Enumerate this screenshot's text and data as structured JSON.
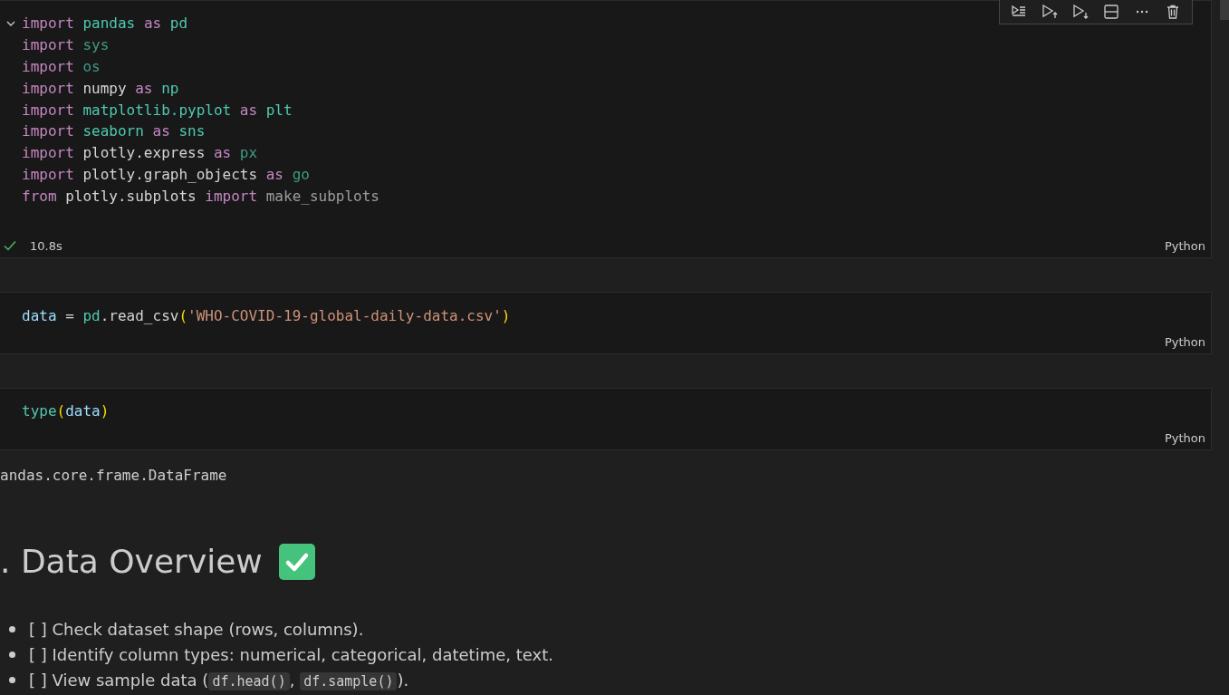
{
  "cell_toolbar": {
    "buttons": [
      {
        "kind": "run-by-line"
      },
      {
        "kind": "run-above"
      },
      {
        "kind": "run-below"
      },
      {
        "kind": "split"
      },
      {
        "kind": "more"
      },
      {
        "kind": "delete"
      }
    ]
  },
  "cells": [
    {
      "kind": "code",
      "expanded": true,
      "succeeded": true,
      "duration": "10.8s",
      "language": "Python",
      "lines": [
        [
          {
            "text": "import ",
            "kind": "kw"
          },
          {
            "text": "pandas ",
            "kind": "mod"
          },
          {
            "text": "as ",
            "kind": "kw"
          },
          {
            "text": "pd",
            "kind": "mod"
          }
        ],
        [
          {
            "text": "import ",
            "kind": "kw"
          },
          {
            "text": "sys",
            "kind": "mod_dim"
          }
        ],
        [
          {
            "text": "import ",
            "kind": "kw"
          },
          {
            "text": "os",
            "kind": "mod_dim"
          }
        ],
        [
          {
            "text": "import ",
            "kind": "kw"
          },
          {
            "text": "numpy ",
            "kind": "plain"
          },
          {
            "text": "as ",
            "kind": "kw"
          },
          {
            "text": "np",
            "kind": "mod"
          }
        ],
        [
          {
            "text": "import ",
            "kind": "kw"
          },
          {
            "text": "matplotlib.pyplot ",
            "kind": "mod"
          },
          {
            "text": "as ",
            "kind": "kw"
          },
          {
            "text": "plt",
            "kind": "mod"
          }
        ],
        [
          {
            "text": "import ",
            "kind": "kw"
          },
          {
            "text": "seaborn ",
            "kind": "mod"
          },
          {
            "text": "as ",
            "kind": "kw"
          },
          {
            "text": "sns",
            "kind": "mod"
          }
        ],
        [
          {
            "text": "import ",
            "kind": "kw"
          },
          {
            "text": "plotly.express ",
            "kind": "plain"
          },
          {
            "text": "as ",
            "kind": "kw"
          },
          {
            "text": "px",
            "kind": "mod_dim"
          }
        ],
        [
          {
            "text": "import ",
            "kind": "kw"
          },
          {
            "text": "plotly.graph_objects ",
            "kind": "plain"
          },
          {
            "text": "as ",
            "kind": "kw"
          },
          {
            "text": "go",
            "kind": "mod_dim"
          }
        ],
        [
          {
            "text": "from ",
            "kind": "kw"
          },
          {
            "text": "plotly.subplots ",
            "kind": "plain"
          },
          {
            "text": "import ",
            "kind": "kw"
          },
          {
            "text": "make_subplots",
            "kind": "dim"
          }
        ]
      ]
    },
    {
      "kind": "code",
      "language": "Python",
      "lines": [
        [
          {
            "text": "data ",
            "kind": "var"
          },
          {
            "text": "= ",
            "kind": "plain"
          },
          {
            "text": "pd",
            "kind": "mod"
          },
          {
            "text": ".read_csv",
            "kind": "plain"
          },
          {
            "text": "(",
            "kind": "paren"
          },
          {
            "text": "'WHO-COVID-19-global-daily-data.csv'",
            "kind": "str"
          },
          {
            "text": ")",
            "kind": "paren"
          }
        ]
      ]
    },
    {
      "kind": "code",
      "language": "Python",
      "lines": [
        [
          {
            "text": "type",
            "kind": "mod"
          },
          {
            "text": "(",
            "kind": "paren"
          },
          {
            "text": "data",
            "kind": "var"
          },
          {
            "text": ")",
            "kind": "paren"
          }
        ]
      ],
      "output": "andas.core.frame.DataFrame"
    },
    {
      "kind": "markdown",
      "heading": ". Data Overview",
      "heading_check": true,
      "items": [
        [
          {
            "text": "[ ] Check dataset shape (rows, columns)."
          }
        ],
        [
          {
            "text": "[ ] Identify column types: numerical, categorical, datetime, text."
          }
        ],
        [
          {
            "text": "[ ] View sample data ("
          },
          {
            "code": "df.head()"
          },
          {
            "text": ", "
          },
          {
            "code": "df.sample()"
          },
          {
            "text": ")."
          }
        ]
      ]
    }
  ]
}
